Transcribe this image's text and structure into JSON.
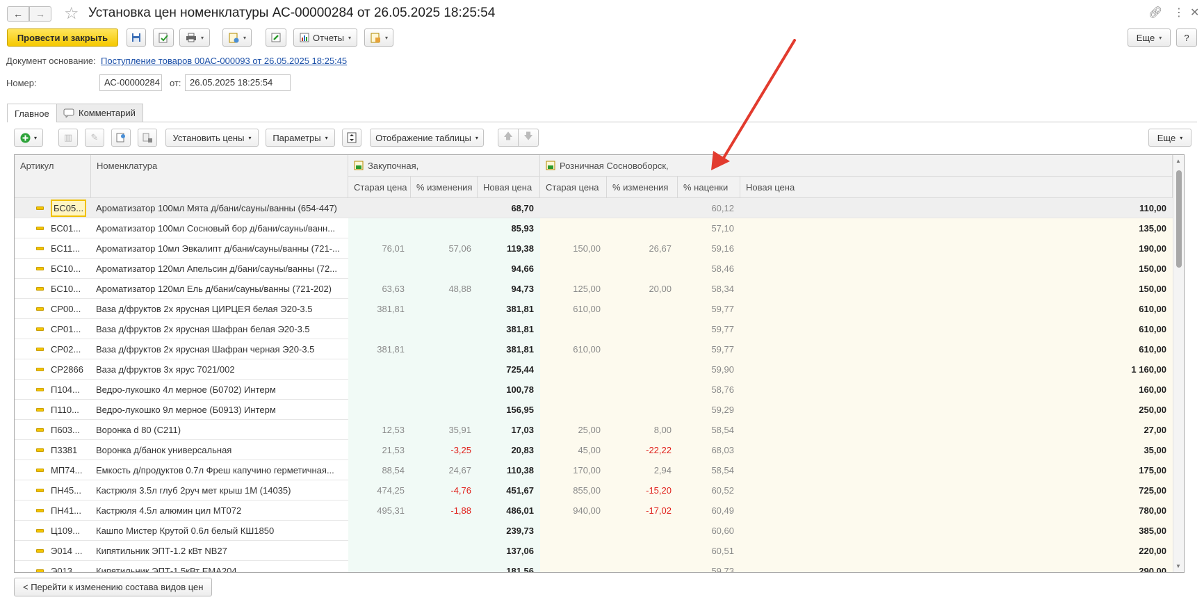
{
  "window": {
    "title": "Установка цен номенклатуры АС-00000284 от 26.05.2025 18:25:54",
    "back_icon": "arrow-left-icon",
    "forward_icon": "arrow-right-icon",
    "star_icon": "star-icon",
    "link_icon": "link-icon",
    "more_icon": "more-vertical-icon",
    "close_icon": "close-icon"
  },
  "toolbar": {
    "post_and_close": "Провести и закрыть",
    "reports": "Отчеты",
    "more": "Еще",
    "help": "?"
  },
  "doc": {
    "basis_label": "Документ основание:",
    "basis_link": "Поступление товаров 00АС-000093 от 26.05.2025 18:25:45",
    "number_label": "Номер:",
    "number_value": "АС-00000284",
    "from_label": "от:",
    "from_value": "26.05.2025 18:25:54"
  },
  "tabs": [
    {
      "label": "Главное",
      "active": true
    },
    {
      "label": "Комментарий",
      "active": false
    }
  ],
  "table_toolbar": {
    "set_prices": "Установить цены",
    "parameters": "Параметры",
    "table_display": "Отображение таблицы",
    "more": "Еще"
  },
  "grid": {
    "headers": {
      "article": "Артикул",
      "nomenclature": "Номенклатура",
      "purchase_group": "Закупочная,",
      "retail_group": "Розничная Сосновоборск,",
      "old_price": "Старая цена",
      "pct_change": "% изменения",
      "new_price": "Новая цена",
      "markup": "% наценки"
    },
    "rows": [
      {
        "article": "БС05...",
        "name": "Ароматизатор 100мл Мята д/бани/сауны/ванны (654-447)",
        "p_old": "",
        "p_pct": "",
        "p_new": "68,70",
        "r_old": "",
        "r_pct": "",
        "markup": "60,12",
        "r_new": "110,00"
      },
      {
        "article": "БС01...",
        "name": "Ароматизатор 100мл Сосновый бор д/бани/сауны/ванн...",
        "p_old": "",
        "p_pct": "",
        "p_new": "85,93",
        "r_old": "",
        "r_pct": "",
        "markup": "57,10",
        "r_new": "135,00"
      },
      {
        "article": "БС11...",
        "name": "Ароматизатор 10мл Эвкалипт д/бани/сауны/ванны (721-...",
        "p_old": "76,01",
        "p_pct": "57,06",
        "p_new": "119,38",
        "r_old": "150,00",
        "r_pct": "26,67",
        "markup": "59,16",
        "r_new": "190,00"
      },
      {
        "article": "БС10...",
        "name": "Ароматизатор 120мл Апельсин д/бани/сауны/ванны (72...",
        "p_old": "",
        "p_pct": "",
        "p_new": "94,66",
        "r_old": "",
        "r_pct": "",
        "markup": "58,46",
        "r_new": "150,00"
      },
      {
        "article": "БС10...",
        "name": "Ароматизатор 120мл Ель д/бани/сауны/ванны (721-202)",
        "p_old": "63,63",
        "p_pct": "48,88",
        "p_new": "94,73",
        "r_old": "125,00",
        "r_pct": "20,00",
        "markup": "58,34",
        "r_new": "150,00"
      },
      {
        "article": "СР00...",
        "name": "Ваза д/фруктов 2х ярусная ЦИРЦЕЯ белая Э20-3.5",
        "p_old": "381,81",
        "p_pct": "",
        "p_new": "381,81",
        "r_old": "610,00",
        "r_pct": "",
        "markup": "59,77",
        "r_new": "610,00"
      },
      {
        "article": "СР01...",
        "name": "Ваза д/фруктов 2х ярусная Шафран белая Э20-3.5",
        "p_old": "",
        "p_pct": "",
        "p_new": "381,81",
        "r_old": "",
        "r_pct": "",
        "markup": "59,77",
        "r_new": "610,00"
      },
      {
        "article": "СР02...",
        "name": "Ваза д/фруктов 2х ярусная Шафран черная Э20-3.5",
        "p_old": "381,81",
        "p_pct": "",
        "p_new": "381,81",
        "r_old": "610,00",
        "r_pct": "",
        "markup": "59,77",
        "r_new": "610,00"
      },
      {
        "article": "СР2866",
        "name": "Ваза д/фруктов 3х ярус 7021/002",
        "p_old": "",
        "p_pct": "",
        "p_new": "725,44",
        "r_old": "",
        "r_pct": "",
        "markup": "59,90",
        "r_new": "1 160,00"
      },
      {
        "article": "П104...",
        "name": "Ведро-лукошко 4л мерное (Б0702) Интерм",
        "p_old": "",
        "p_pct": "",
        "p_new": "100,78",
        "r_old": "",
        "r_pct": "",
        "markup": "58,76",
        "r_new": "160,00"
      },
      {
        "article": "П110...",
        "name": "Ведро-лукошко 9л мерное (Б0913) Интерм",
        "p_old": "",
        "p_pct": "",
        "p_new": "156,95",
        "r_old": "",
        "r_pct": "",
        "markup": "59,29",
        "r_new": "250,00"
      },
      {
        "article": "П603...",
        "name": "Воронка d 80 (С211)",
        "p_old": "12,53",
        "p_pct": "35,91",
        "p_new": "17,03",
        "r_old": "25,00",
        "r_pct": "8,00",
        "markup": "58,54",
        "r_new": "27,00"
      },
      {
        "article": "П3381",
        "name": "Воронка д/банок универсальная",
        "p_old": "21,53",
        "p_pct": "-3,25",
        "p_new": "20,83",
        "r_old": "45,00",
        "r_pct": "-22,22",
        "markup": "68,03",
        "r_new": "35,00"
      },
      {
        "article": "МП74...",
        "name": "Емкость д/продуктов 0.7л Фреш капучино герметичная...",
        "p_old": "88,54",
        "p_pct": "24,67",
        "p_new": "110,38",
        "r_old": "170,00",
        "r_pct": "2,94",
        "markup": "58,54",
        "r_new": "175,00"
      },
      {
        "article": "ПН45...",
        "name": "Кастрюля 3.5л глуб 2руч мет крыш 1М (14035)",
        "p_old": "474,25",
        "p_pct": "-4,76",
        "p_new": "451,67",
        "r_old": "855,00",
        "r_pct": "-15,20",
        "markup": "60,52",
        "r_new": "725,00"
      },
      {
        "article": "ПН41...",
        "name": "Кастрюля 4.5л алюмин цил МТ072",
        "p_old": "495,31",
        "p_pct": "-1,88",
        "p_new": "486,01",
        "r_old": "940,00",
        "r_pct": "-17,02",
        "markup": "60,49",
        "r_new": "780,00"
      },
      {
        "article": "Ц109...",
        "name": "Кашпо Мистер Крутой 0.6л белый КШ1850",
        "p_old": "",
        "p_pct": "",
        "p_new": "239,73",
        "r_old": "",
        "r_pct": "",
        "markup": "60,60",
        "r_new": "385,00"
      },
      {
        "article": "Э014 ...",
        "name": "Кипятильник ЭПТ-1.2 кВт NB27",
        "p_old": "",
        "p_pct": "",
        "p_new": "137,06",
        "r_old": "",
        "r_pct": "",
        "markup": "60,51",
        "r_new": "220,00"
      },
      {
        "article": "Э013...",
        "name": "Кипятильник ЭПТ-1.5кВт ЕМА204",
        "p_old": "",
        "p_pct": "",
        "p_new": "181,56",
        "r_old": "",
        "r_pct": "",
        "markup": "59,73",
        "r_new": "290,00"
      }
    ]
  },
  "footer": {
    "change_price_types": "< Перейти к изменению состава видов цен"
  },
  "annotation": {
    "arrow_color": "#e23b2e"
  }
}
